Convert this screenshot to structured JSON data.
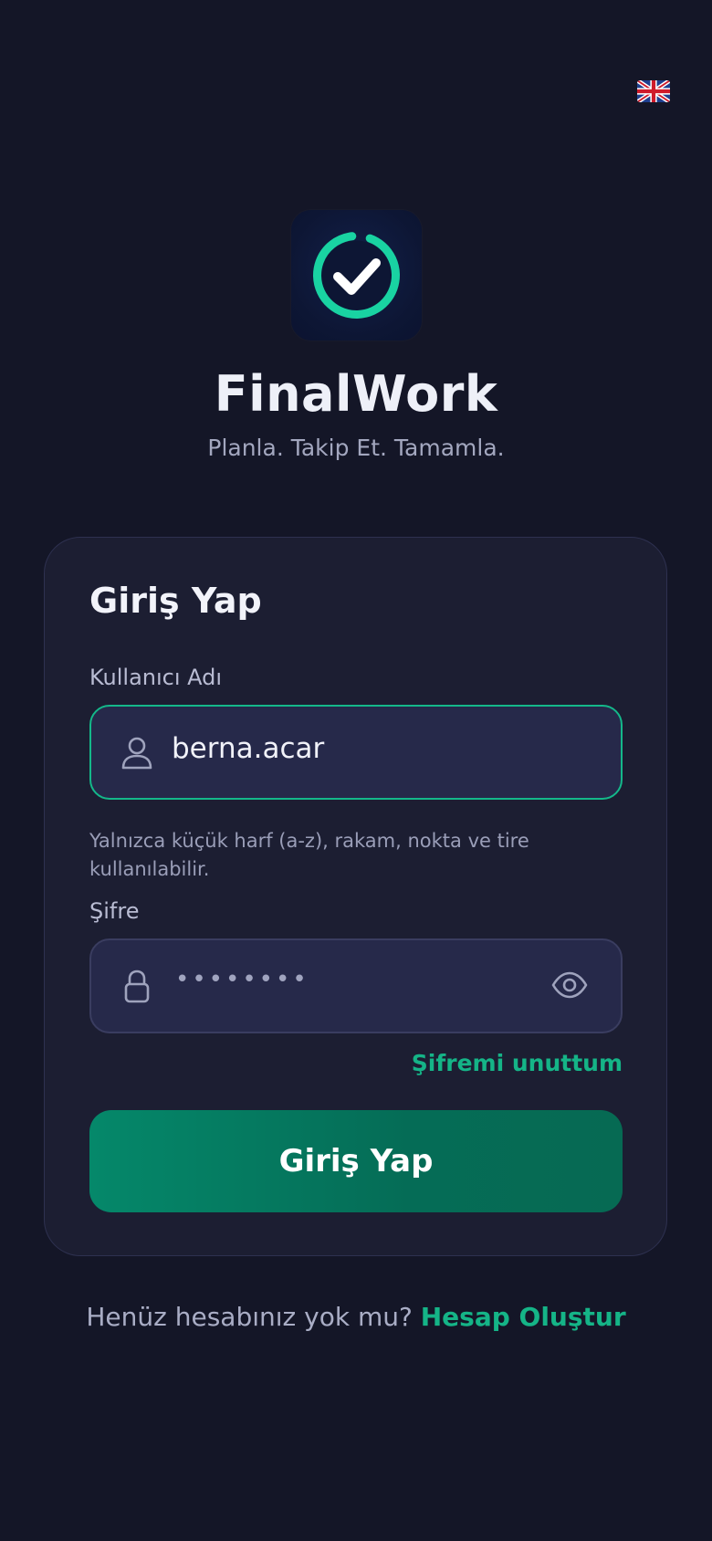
{
  "language": {
    "icon": "uk-flag-icon",
    "code": "EN"
  },
  "brand": {
    "logo_icon": "check-circle-icon",
    "name": "FinalWork",
    "tagline": "Planla. Takip Et. Tamamla.",
    "accent": "#14b88a"
  },
  "login_card": {
    "title": "Giriş Yap",
    "username": {
      "label": "Kullanıcı Adı",
      "icon": "user-icon",
      "value": "berna.acar",
      "helper": "Yalnızca küçük harf (a-z), rakam, nokta ve tire kullanılabilir."
    },
    "password": {
      "label": "Şifre",
      "icon": "lock-icon",
      "masked_value": "••••••••",
      "toggle_icon": "eye-icon"
    },
    "forgot_label": "Şifremi unuttum",
    "submit_label": "Giriş Yap"
  },
  "signup": {
    "prompt": "Henüz hesabınız yok mu?",
    "link_label": "Hesap Oluştur"
  },
  "colors": {
    "background": "#141627",
    "card": "#1c1e32",
    "input": "#26294a",
    "button": "#05886a",
    "link": "#15b487"
  }
}
